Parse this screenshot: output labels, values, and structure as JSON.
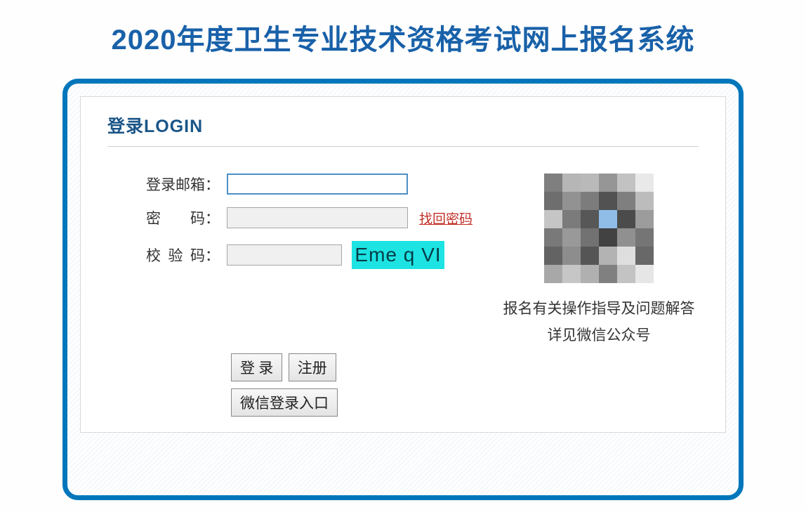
{
  "page": {
    "title": "2020年度卫生专业技术资格考试网上报名系统"
  },
  "login": {
    "header": "登录LOGIN",
    "email_label": "登录邮箱：",
    "password_label": "密　　码：",
    "captcha_label": "校  验  码：",
    "captcha_text": "Eme q VI",
    "forgot_password": "找回密码",
    "login_button": "登 录",
    "register_button": "注册",
    "wechat_login_button": "微信登录入口"
  },
  "sidebar": {
    "qr_info_line1": "报名有关操作指导及问题解答",
    "qr_info_line2": "详见微信公众号"
  }
}
